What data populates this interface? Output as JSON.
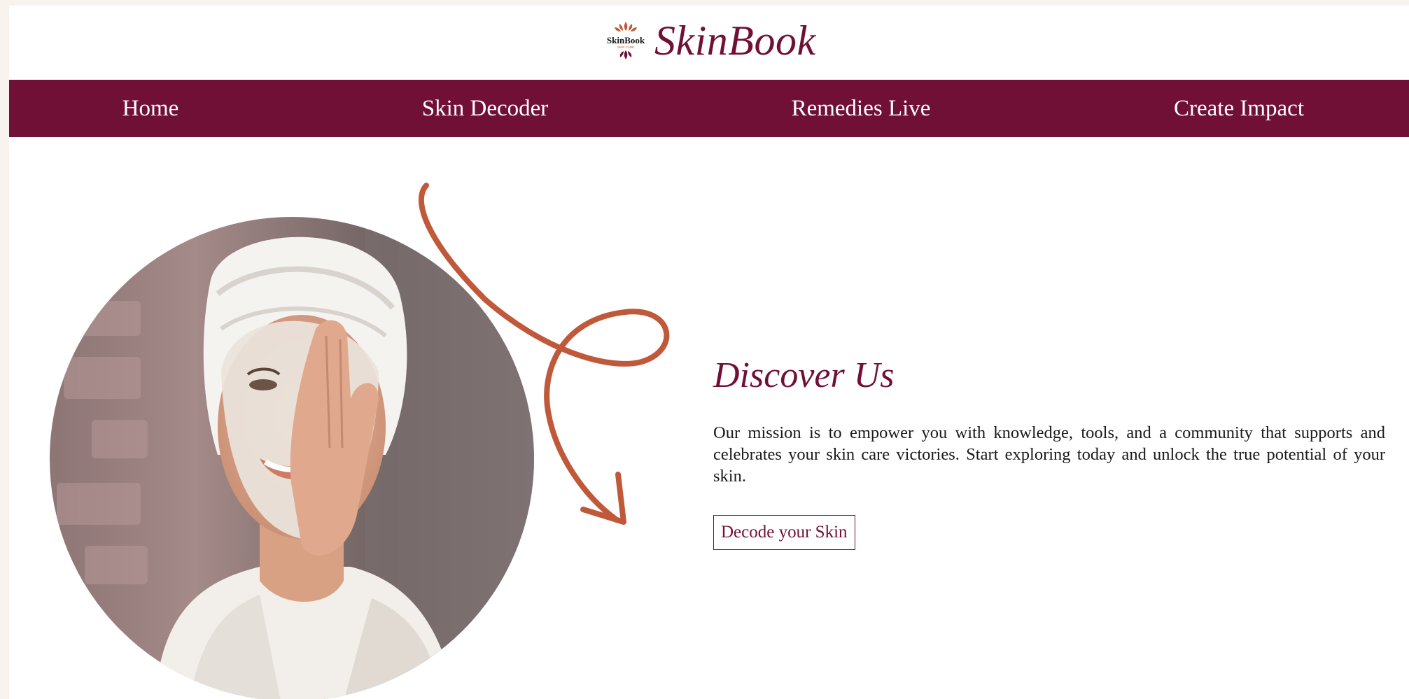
{
  "header": {
    "brand": "SkinBook",
    "logo_text": "SkinBook",
    "logo_subtext": "SKIN CARE"
  },
  "nav": {
    "items": [
      {
        "label": "Home"
      },
      {
        "label": "Skin Decoder"
      },
      {
        "label": "Remedies Live"
      },
      {
        "label": "Create Impact"
      }
    ]
  },
  "hero": {
    "heading": "Discover Us",
    "mission": "Our mission is to empower you with knowledge, tools, and a community that supports and celebrates your skin care victories. Start exploring today and unlock the true potential of your skin.",
    "cta_label": "Decode your Skin",
    "image_icon": "woman-face-mask-photo",
    "arrow_icon": "decorative-loop-arrow-icon"
  },
  "colors": {
    "brand": "#711037",
    "accent_arrow": "#c0583a",
    "background": "#ffffff",
    "page_margin": "#f8f3ef"
  }
}
